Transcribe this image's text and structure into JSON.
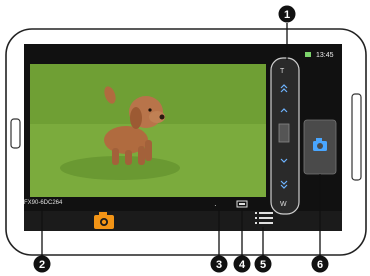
{
  "status": {
    "time": "13:45"
  },
  "camera": {
    "file_name": "FX90-6DC264",
    "flash_mark": "·"
  },
  "zoom": {
    "tele_label": "T",
    "wide_label": "W"
  },
  "callouts": [
    {
      "label": "1",
      "target": "zoom-bar"
    },
    {
      "label": "2",
      "target": "file-name"
    },
    {
      "label": "3",
      "target": "flash-indicator"
    },
    {
      "label": "4",
      "target": "battery-indicator"
    },
    {
      "label": "5",
      "target": "menu-icon"
    },
    {
      "label": "6",
      "target": "shutter-button"
    }
  ],
  "colors": {
    "phone_body": "#ffffff",
    "screen": "#111111",
    "grass": "#7cae3c",
    "camera_icon": "#f29416",
    "callout": "#111111"
  }
}
